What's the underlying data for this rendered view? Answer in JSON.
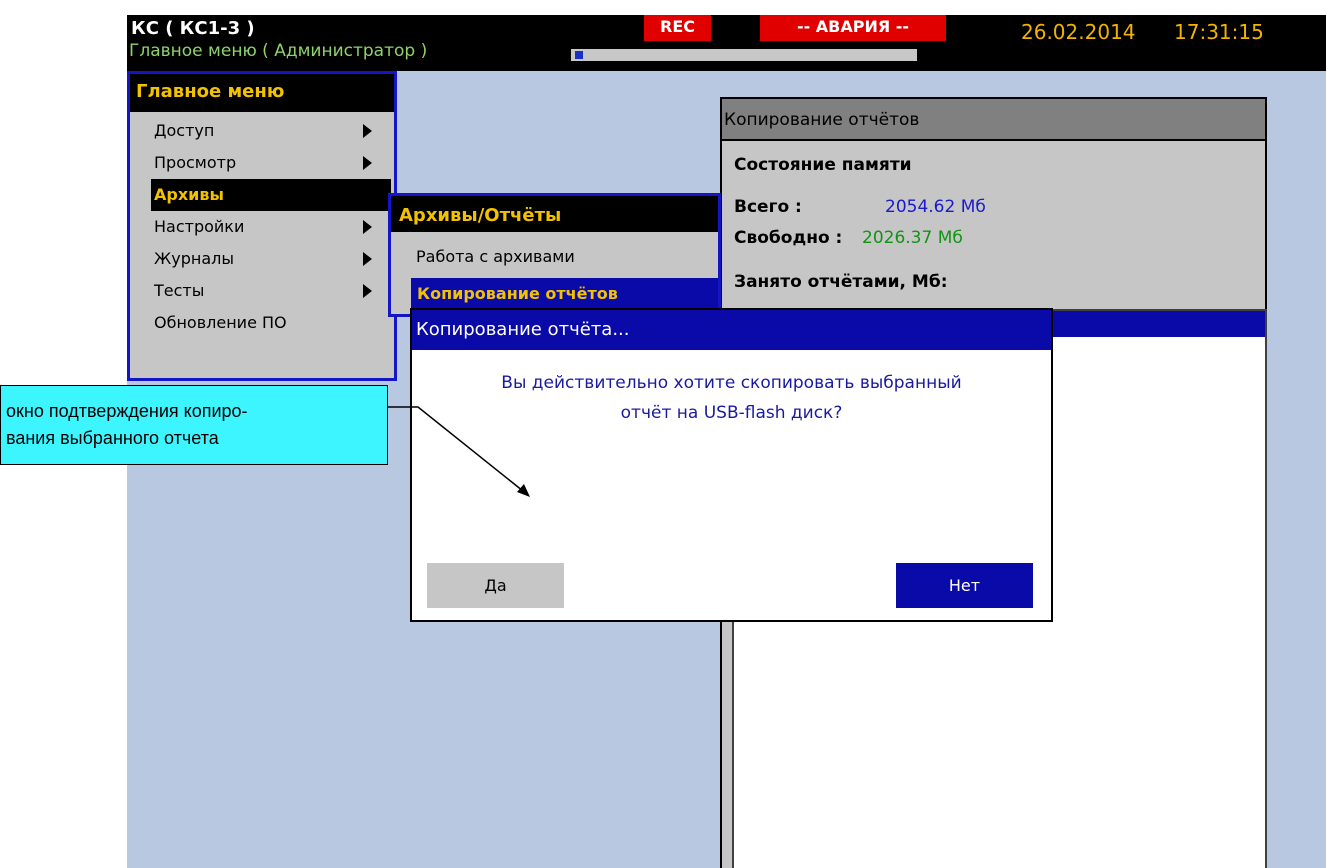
{
  "topbar": {
    "title": "КС ( КС1-3 )",
    "subtitle": "Главное меню ( Администратор )",
    "rec": "REC",
    "alarm": "-- АВАРИЯ --",
    "date": "26.02.2014",
    "time": "17:31:15"
  },
  "main_menu": {
    "header": "Главное меню",
    "items": [
      {
        "label": "Доступ",
        "has_submenu": true
      },
      {
        "label": "Просмотр",
        "has_submenu": true
      },
      {
        "label": "Архивы",
        "has_submenu": true,
        "selected": true
      },
      {
        "label": "Настройки",
        "has_submenu": true
      },
      {
        "label": "Журналы",
        "has_submenu": true
      },
      {
        "label": "Тесты",
        "has_submenu": true
      },
      {
        "label": "Обновление ПО",
        "has_submenu": false
      }
    ]
  },
  "submenu": {
    "header": "Архивы/Отчёты",
    "items": [
      {
        "label": "Работа с архивами"
      },
      {
        "label": "Копирование отчётов",
        "selected": true
      }
    ]
  },
  "copy_panel": {
    "title": "Копирование отчётов",
    "memory_label": "Состояние памяти",
    "total_label": "Всего :",
    "total_value": "2054.62 Мб",
    "free_label": "Свободно :",
    "free_value": "2026.37 Мб",
    "used_label": "Занято отчётами, Мб:"
  },
  "dialog": {
    "title": "Копирование отчёта...",
    "line1": "Вы действительно хотите скопировать выбранный",
    "line2": "отчёт на USB-flash диск?",
    "yes_label": "Да",
    "no_label": "Нет"
  },
  "callout": {
    "line1": "окно подтверждения копиро-",
    "line2": "вания выбранного отчета"
  },
  "colors": {
    "screen_bg": "#b7c8e0",
    "accent_blue": "#0a0aa8",
    "menu_text_yellow": "#f2c200",
    "alarm_red": "#e00000",
    "total_value_blue": "#1a1acc",
    "free_value_green": "#129312",
    "callout_cyan": "#3df5ff"
  }
}
